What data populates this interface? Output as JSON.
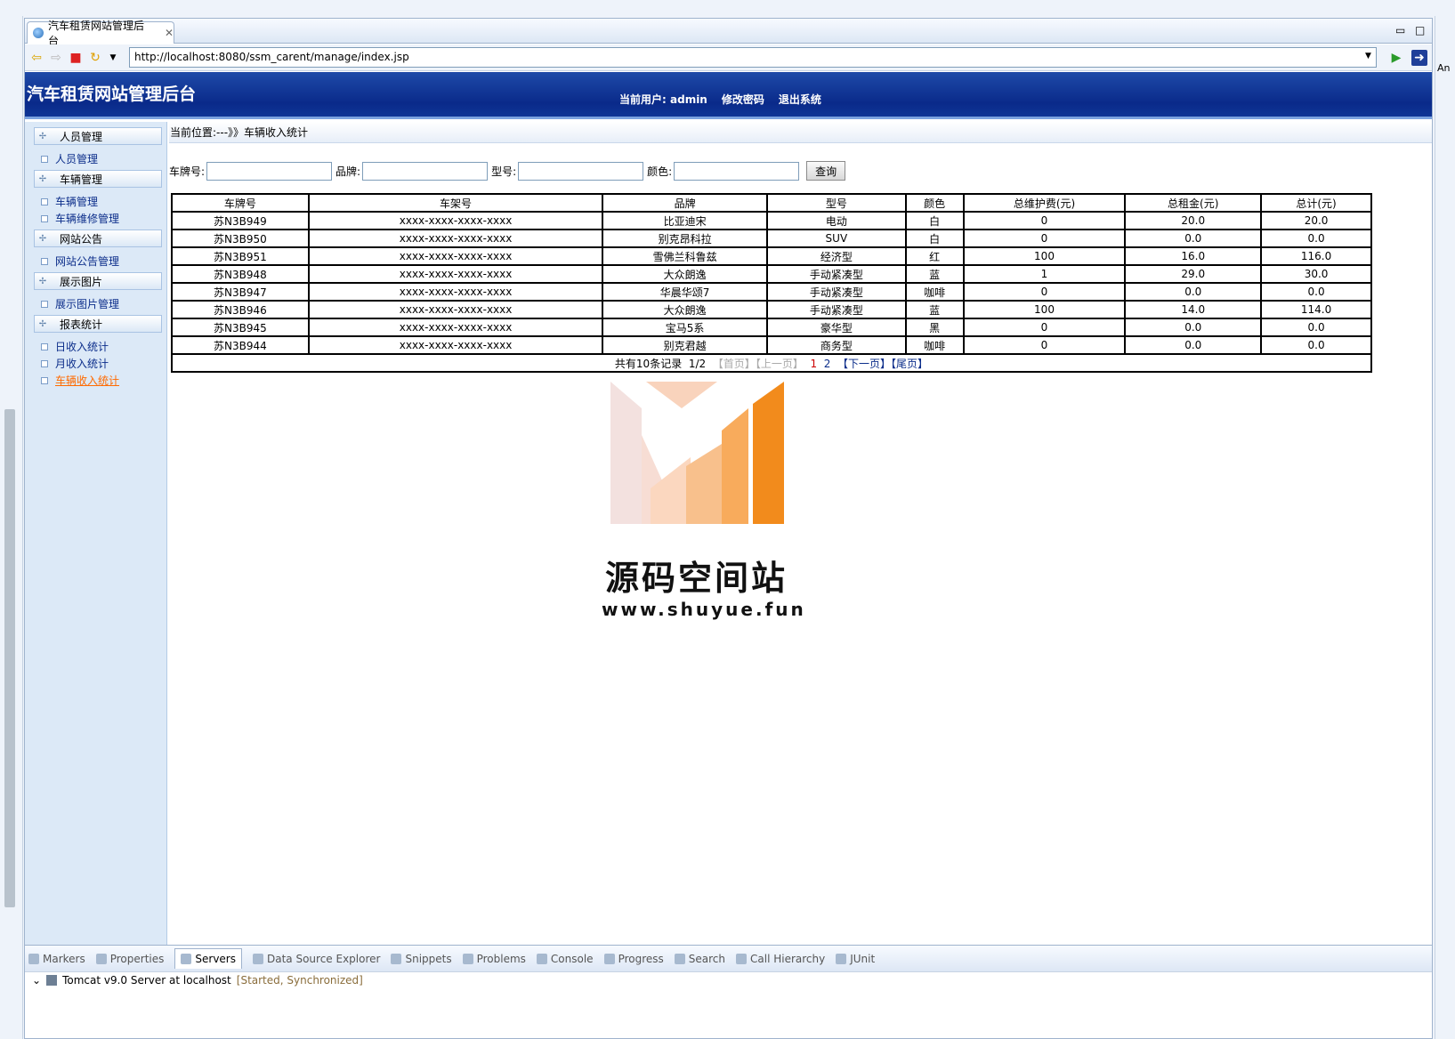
{
  "ide": {
    "editor_tab_title": "汽车租赁网站管理后台",
    "url": "http://localhost:8080/ssm_carent/manage/index.jsp",
    "right_gutter_text": "An"
  },
  "site": {
    "title": "汽车租赁网站管理后台",
    "current_user_label": "当前用户:",
    "current_user": "admin",
    "change_password": "修改密码",
    "logout": "退出系统"
  },
  "sidebar": {
    "groups": [
      {
        "label": "人员管理",
        "items": [
          {
            "label": "人员管理"
          }
        ]
      },
      {
        "label": "车辆管理",
        "items": [
          {
            "label": "车辆管理"
          },
          {
            "label": "车辆维修管理"
          }
        ]
      },
      {
        "label": "网站公告",
        "items": [
          {
            "label": "网站公告管理"
          }
        ]
      },
      {
        "label": "展示图片",
        "items": [
          {
            "label": "展示图片管理"
          }
        ]
      },
      {
        "label": "报表统计",
        "items": [
          {
            "label": "日收入统计"
          },
          {
            "label": "月收入统计"
          },
          {
            "label": "车辆收入统计"
          }
        ]
      }
    ]
  },
  "breadcrumb": "当前位置:---》》车辆收入统计",
  "search": {
    "plate_label": "车牌号:",
    "brand_label": "品牌:",
    "model_label": "型号:",
    "color_label": "颜色:",
    "submit_label": "查询"
  },
  "table": {
    "headers": [
      "车牌号",
      "车架号",
      "品牌",
      "型号",
      "颜色",
      "总维护费(元)",
      "总租金(元)",
      "总计(元)"
    ],
    "rows": [
      [
        "苏N3B949",
        "xxxx-xxxx-xxxx-xxxx",
        "比亚迪宋",
        "电动",
        "白",
        "0",
        "20.0",
        "20.0"
      ],
      [
        "苏N3B950",
        "xxxx-xxxx-xxxx-xxxx",
        "别克昂科拉",
        "SUV",
        "白",
        "0",
        "0.0",
        "0.0"
      ],
      [
        "苏N3B951",
        "xxxx-xxxx-xxxx-xxxx",
        "雪佛兰科鲁兹",
        "经济型",
        "红",
        "100",
        "16.0",
        "116.0"
      ],
      [
        "苏N3B948",
        "xxxx-xxxx-xxxx-xxxx",
        "大众朗逸",
        "手动紧凑型",
        "蓝",
        "1",
        "29.0",
        "30.0"
      ],
      [
        "苏N3B947",
        "xxxx-xxxx-xxxx-xxxx",
        "华晨华颂7",
        "手动紧凑型",
        "咖啡",
        "0",
        "0.0",
        "0.0"
      ],
      [
        "苏N3B946",
        "xxxx-xxxx-xxxx-xxxx",
        "大众朗逸",
        "手动紧凑型",
        "蓝",
        "100",
        "14.0",
        "114.0"
      ],
      [
        "苏N3B945",
        "xxxx-xxxx-xxxx-xxxx",
        "宝马5系",
        "豪华型",
        "黑",
        "0",
        "0.0",
        "0.0"
      ],
      [
        "苏N3B944",
        "xxxx-xxxx-xxxx-xxxx",
        "别克君越",
        "商务型",
        "咖啡",
        "0",
        "0.0",
        "0.0"
      ]
    ]
  },
  "pager": {
    "total": "共有10条记录",
    "page": "1/2",
    "first": "【首页】",
    "prev": "【上一页】",
    "p1": "1",
    "p2": "2",
    "next": "【下一页】",
    "last": "【尾页】"
  },
  "watermark": {
    "text_cn": "源码空间站",
    "text_url": "www.shuyue.fun"
  },
  "bottom_panel": {
    "tabs": [
      "Markers",
      "Properties",
      "Servers",
      "Data Source Explorer",
      "Snippets",
      "Problems",
      "Console",
      "Progress",
      "Search",
      "Call Hierarchy",
      "JUnit"
    ],
    "server_name": "Tomcat v9.0 Server at localhost",
    "server_status": "[Started, Synchronized]"
  },
  "colors": {
    "banner": "#0a2a8a",
    "active_link": "#ff6a00",
    "sidebar_bg": "#dce9f7"
  }
}
